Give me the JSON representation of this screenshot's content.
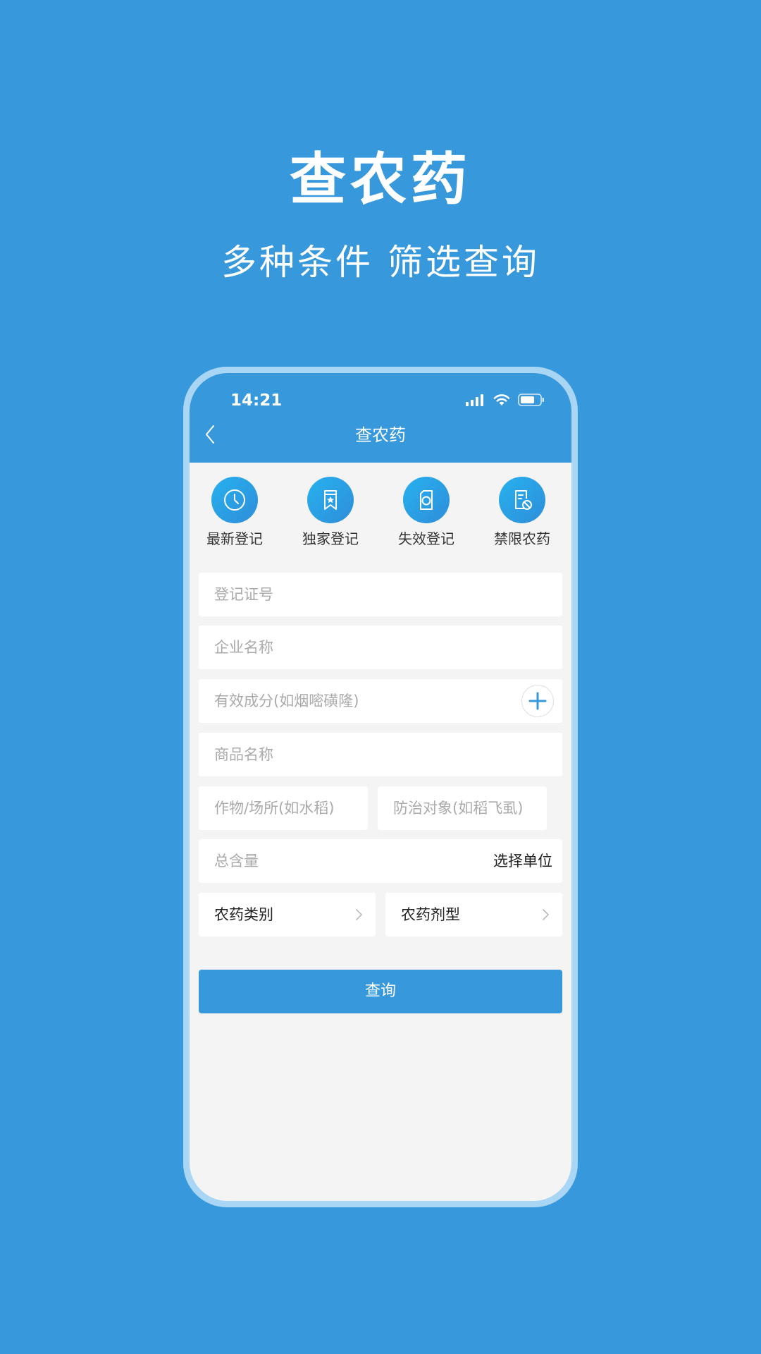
{
  "promo": {
    "title": "查农药",
    "subtitle": "多种条件 筛选查询"
  },
  "status_bar": {
    "time": "14:21",
    "icons": [
      "cellular-signal-icon",
      "wifi-icon",
      "battery-icon"
    ]
  },
  "nav": {
    "title": "查农药",
    "back_icon": "chevron-left-icon"
  },
  "quick_links": [
    {
      "label": "最新登记",
      "icon": "clock-icon"
    },
    {
      "label": "独家登记",
      "icon": "bookmark-star-icon"
    },
    {
      "label": "失效登记",
      "icon": "document-circle-icon"
    },
    {
      "label": "禁限农药",
      "icon": "document-ban-icon"
    }
  ],
  "form": {
    "registration_no_placeholder": "登记证号",
    "company_name_placeholder": "企业名称",
    "active_ingredient_placeholder": "有效成分(如烟嘧磺隆)",
    "product_name_placeholder": "商品名称",
    "crop_placeholder": "作物/场所(如水稻)",
    "target_placeholder": "防治对象(如稻飞虱)",
    "total_content_placeholder": "总含量",
    "unit_select_label": "选择单位",
    "pesticide_category_label": "农药类别",
    "formulation_label": "农药剂型",
    "query_button_label": "查询"
  },
  "colors": {
    "background": "#3798DC",
    "primary": "#3798DC",
    "frame": "#A9D6F5",
    "screen_bg": "#F4F4F4",
    "placeholder": "#AAAAAA"
  }
}
